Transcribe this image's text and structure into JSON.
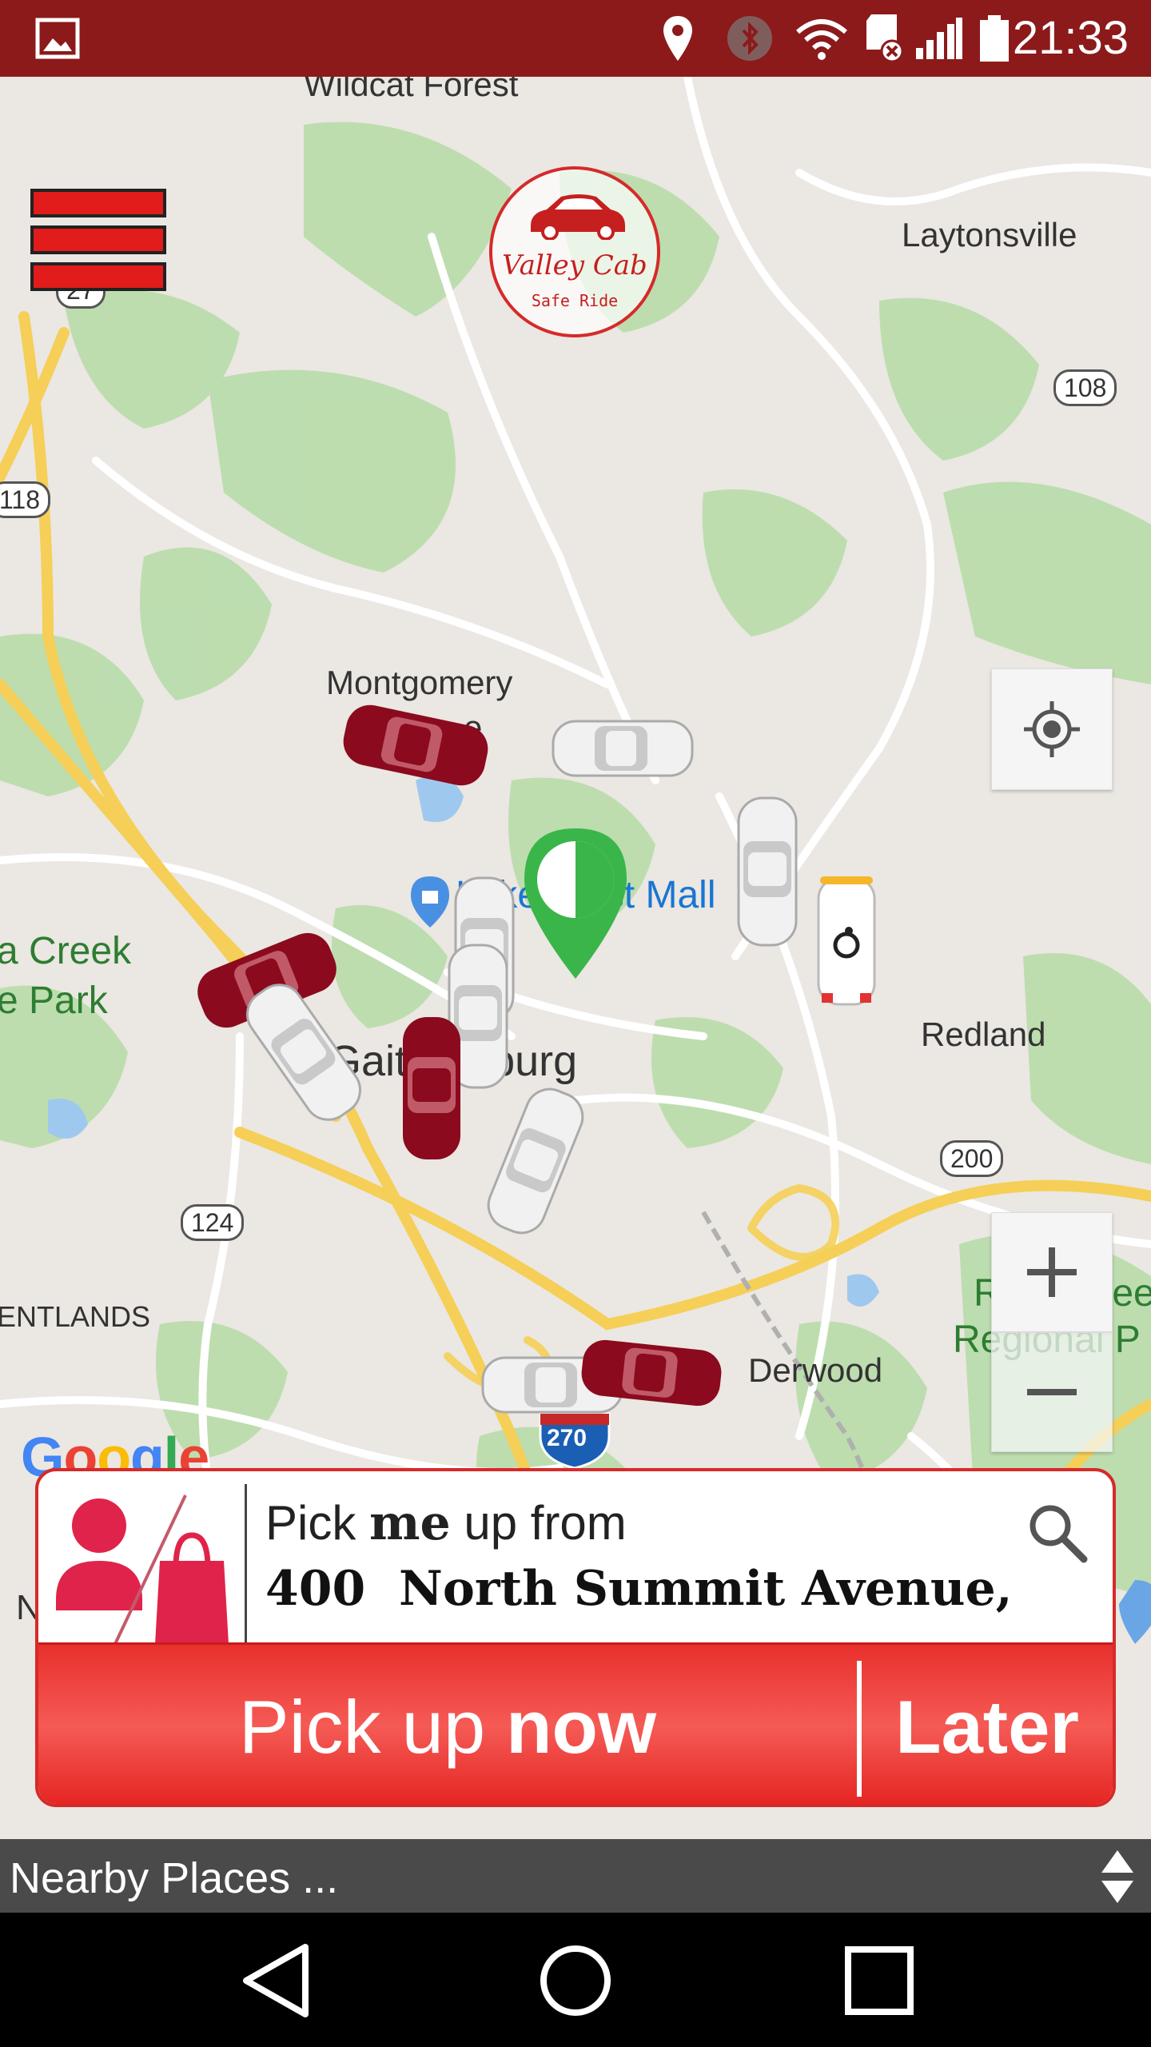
{
  "status_bar": {
    "time": "21:33",
    "icons": [
      "image-icon",
      "location-icon",
      "bluetooth-icon",
      "wifi-icon",
      "sd-card-icon",
      "signal-icon",
      "battery-icon"
    ]
  },
  "brand": {
    "name": "Valley Cab",
    "tagline": "Safe Ride",
    "color": "#d62a2a"
  },
  "map": {
    "labels": {
      "wildcat_forest": "Wildcat Forest",
      "laytonsville": "Laytonsville",
      "montgomery": "Montgomery",
      "village_partial": "e",
      "mall": "Lakeforest Mall",
      "creek": "a Creek",
      "park": "e Park",
      "gaithersburg": "Gaithersburg",
      "redland": "Redland",
      "rock_creek_1": "Rock Cree",
      "rock_creek_2": "Regional P",
      "derwood": "Derwood",
      "entlands": "ENTLANDS",
      "n_partial": "N"
    },
    "route_shields": [
      "27",
      "108",
      "118",
      "124",
      "200",
      "270"
    ],
    "attribution": "Google"
  },
  "pickup": {
    "prefix": "Pick",
    "emphasis": "me",
    "suffix": "up from",
    "address": "400  North Summit Avenue,",
    "now_label_regular": "Pick up",
    "now_label_bold": "now",
    "later_label": "Later"
  },
  "nearby": {
    "label": "Nearby Places ..."
  },
  "colors": {
    "status_bar": "#8c1a1a",
    "accent": "#e21b1b",
    "pin": "#3ab54a",
    "maroon_car": "#8b0a1e"
  }
}
